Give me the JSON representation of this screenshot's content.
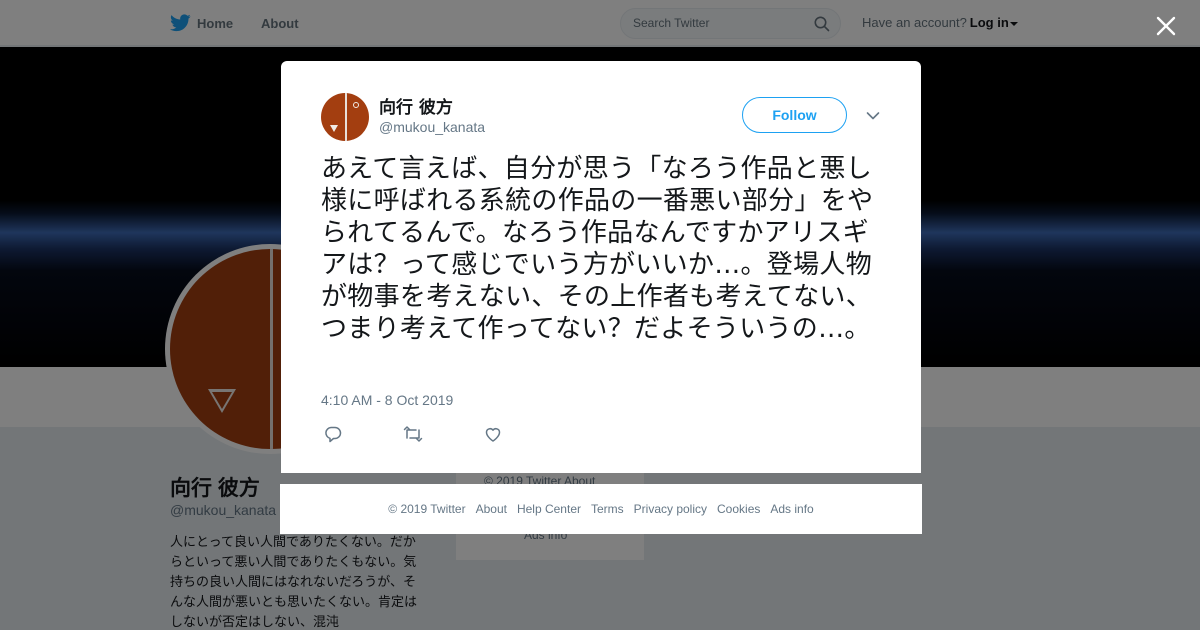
{
  "topbar": {
    "home_label": "Home",
    "about_label": "About",
    "search_placeholder": "Search Twitter",
    "account_prompt": "Have an account?",
    "login_label": "Log in"
  },
  "profile": {
    "name": "向行 彼方",
    "handle": "@mukou_kanata",
    "bio": "人にとって良い人間でありたくない。だからといって悪い人間でありたくもない。気持ちの良い人間にはなれないだろうが、そんな人間が悪いとも思いたくない。肯定はしないが否定はしない、混沌"
  },
  "side_card": {
    "line1": "© 2019 Twitter   About",
    "line2": "Ads info"
  },
  "tweet": {
    "fullname": "向行 彼方",
    "username": "@mukou_kanata",
    "follow_label": "Follow",
    "text": "あえて言えば、自分が思う「なろう作品と悪し様に呼ばれる系統の作品の一番悪い部分」をやられてるんで。なろう作品なんですかアリスギアは？って感じでいう方がいいか…。登場人物が物事を考えない、その上作者も考えてない、つまり考えて作ってない？だよそういうの…。",
    "timestamp": "4:10 AM - 8 Oct 2019"
  },
  "footer": {
    "copyright": "© 2019 Twitter",
    "about": "About",
    "help": "Help Center",
    "terms": "Terms",
    "privacy": "Privacy policy",
    "cookies": "Cookies",
    "ads": "Ads info"
  },
  "colors": {
    "accent": "#1da1f2",
    "avatar_bg": "#a33e10",
    "text_secondary": "#657786"
  },
  "icons": [
    "twitter-bird-icon",
    "search-icon",
    "close-icon",
    "chevron-down-icon",
    "reply-icon",
    "retweet-icon",
    "like-icon"
  ]
}
